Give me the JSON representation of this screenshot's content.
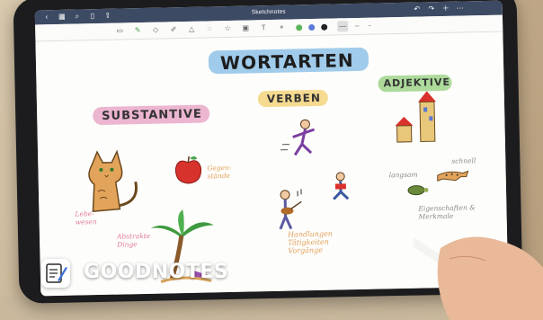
{
  "app": {
    "title": "Sketchnotes",
    "brand": "GOODNOTES"
  },
  "toolbar": {
    "icons": [
      "back-icon",
      "grid-icon",
      "search-icon",
      "bookmark-icon",
      "share-icon"
    ],
    "tools": [
      "reader-icon",
      "pen-icon",
      "eraser-icon",
      "highlighter-icon",
      "shapes-icon",
      "lasso-icon",
      "sticker-icon",
      "image-icon",
      "text-icon",
      "pointer-icon"
    ],
    "colors": [
      "#5ab55a",
      "#5c7bd9",
      "#222222"
    ]
  },
  "page": {
    "title": "WORTARTEN",
    "sections": {
      "substantive": {
        "label": "SUBSTANTIVE",
        "color": "#e9a8c8"
      },
      "verben": {
        "label": "VERBEN",
        "color": "#f3d37c"
      },
      "adjektive": {
        "label": "ADJEKTIVE",
        "color": "#9fd48a"
      }
    },
    "notes": {
      "lebewesen": "Lebe-\nwesen",
      "gegenstande": "Gegen-\nstände",
      "abstrakte": "Abstrakte\nDinge",
      "handlungen": "Handlungen\nTätigkeiten\nVorgänge",
      "langsam": "langsam",
      "schnell": "schnell",
      "eigenschaften": "Eigenschaften &\nMerkmale"
    },
    "title_highlight": "#8fc2e8"
  }
}
